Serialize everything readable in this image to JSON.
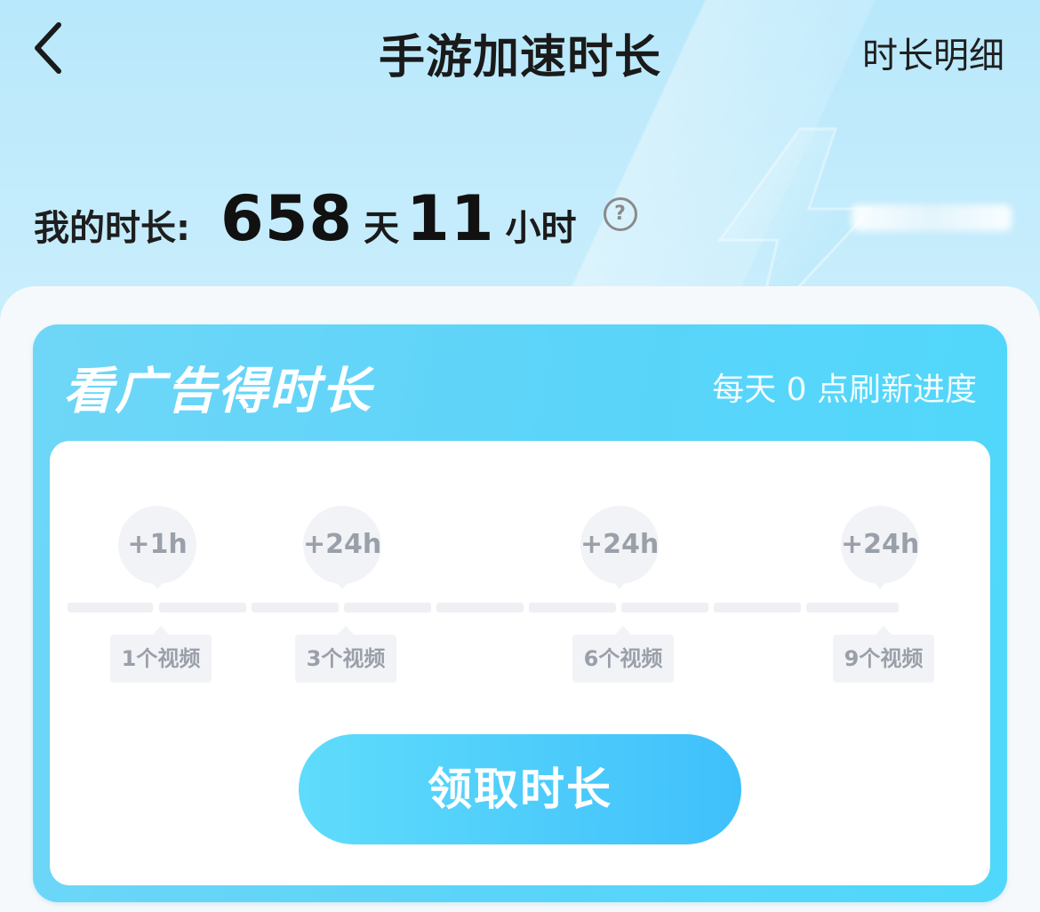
{
  "header": {
    "title": "手游加速时长",
    "detail_link": "时长明细"
  },
  "balance": {
    "label": "我的时长:",
    "days": "658",
    "days_unit": "天",
    "hours": "11",
    "hours_unit": "小时",
    "help_symbol": "?"
  },
  "ad_card": {
    "title": "看广告得时长",
    "refresh_note": "每天 0 点刷新进度",
    "progress_current": 0,
    "rewards": [
      {
        "reward": "+1h",
        "milestone": "1个视频"
      },
      {
        "reward": "+24h",
        "milestone": "3个视频"
      },
      {
        "reward": "+24h",
        "milestone": "6个视频"
      },
      {
        "reward": "+24h",
        "milestone": "9个视频"
      }
    ],
    "claim_button": "领取时长"
  },
  "colors": {
    "accent": "#4fd8fb",
    "button_end": "#3fc0fb",
    "muted_text": "#9aa0aa"
  }
}
